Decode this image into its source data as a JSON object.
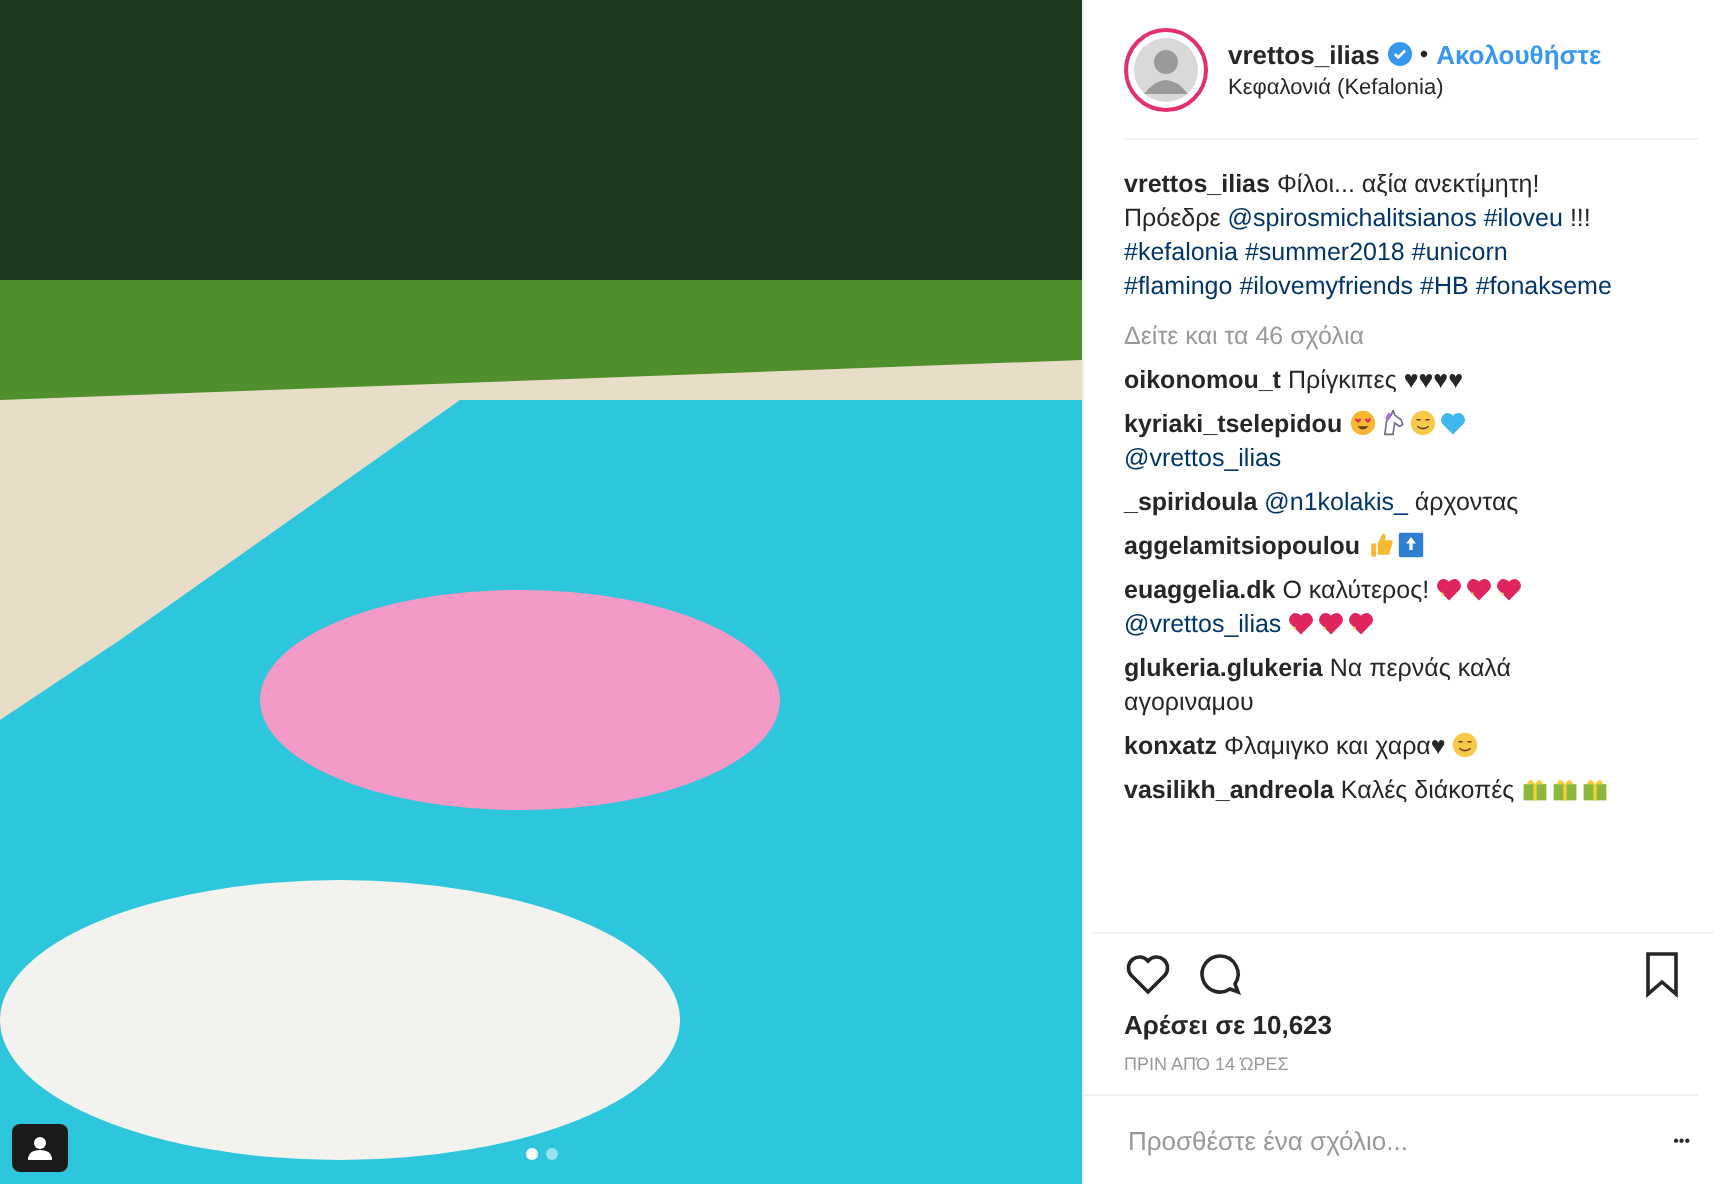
{
  "photo": {
    "dots": [
      {
        "selected": true
      },
      {
        "selected": false
      }
    ],
    "tagged": true
  },
  "header": {
    "username": "vrettos_ilias",
    "verified": true,
    "separator": "•",
    "follow": "Ακολουθήστε",
    "location": "Κεφαλονιά (Kefalonia)"
  },
  "caption": {
    "username": "vrettos_ilias",
    "parts": [
      {
        "kind": "text",
        "text": "Φίλοι... αξία ανεκτίμητη! Πρόεδρε"
      },
      {
        "kind": "link",
        "text": "@spirosmichalitsianos"
      },
      {
        "kind": "link",
        "text": "#iloveu"
      },
      {
        "kind": "text",
        "text": "!!!"
      },
      {
        "kind": "link",
        "text": "#kefalonia"
      },
      {
        "kind": "link",
        "text": "#summer2018"
      },
      {
        "kind": "link",
        "text": "#unicorn"
      },
      {
        "kind": "link",
        "text": "#flamingo"
      },
      {
        "kind": "link",
        "text": "#ilovemyfriends"
      },
      {
        "kind": "link",
        "text": "#HB"
      },
      {
        "kind": "link",
        "text": "#fonakseme"
      }
    ]
  },
  "view_all": "Δείτε και τα 46 σχόλια",
  "comments": [
    {
      "username": "oikonomou_t",
      "parts": [
        {
          "kind": "text",
          "text": "Πρίγκιπες ♥♥♥♥"
        }
      ]
    },
    {
      "username": "kyriaki_tselepidou",
      "parts": [
        {
          "kind": "heart-eyes"
        },
        {
          "kind": "unicorn"
        },
        {
          "kind": "smile"
        },
        {
          "kind": "blue-heart"
        },
        {
          "kind": "link",
          "text": "@vrettos_ilias"
        }
      ]
    },
    {
      "username": "_spiridoula",
      "parts": [
        {
          "kind": "link",
          "text": "@n1kolakis_"
        },
        {
          "kind": "text",
          "text": "άρχοντας"
        }
      ]
    },
    {
      "username": "aggelamitsiopoulou",
      "parts": [
        {
          "kind": "thumbs-up"
        },
        {
          "kind": "top"
        }
      ]
    },
    {
      "username": "euaggelia.dk",
      "parts": [
        {
          "kind": "text",
          "text": "Ο καλύτερος!"
        },
        {
          "kind": "sparkle-heart"
        },
        {
          "kind": "sparkle-heart"
        },
        {
          "kind": "sparkle-heart"
        },
        {
          "kind": "link",
          "text": "@vrettos_ilias"
        },
        {
          "kind": "sparkle-heart"
        },
        {
          "kind": "sparkle-heart"
        },
        {
          "kind": "sparkle-heart"
        }
      ]
    },
    {
      "username": "glukeria.glukeria",
      "parts": [
        {
          "kind": "text",
          "text": "Να περνάς καλά αγοριναμου"
        }
      ]
    },
    {
      "username": "konxatz",
      "parts": [
        {
          "kind": "text",
          "text": "Φλαμιγκο και χαρα♥"
        },
        {
          "kind": "smile"
        }
      ]
    },
    {
      "username": "vasilikh_andreola",
      "parts": [
        {
          "kind": "text",
          "text": "Καλές διάκοπές"
        },
        {
          "kind": "gift"
        },
        {
          "kind": "gift"
        },
        {
          "kind": "gift"
        }
      ]
    }
  ],
  "likes": "Αρέσει σε 10,623",
  "time": "ΠΡΙΝ ΑΠΌ 14 ΏΡΕΣ",
  "add_comment": {
    "placeholder": "Προσθέστε ένα σχόλιο...",
    "more": "•••"
  }
}
